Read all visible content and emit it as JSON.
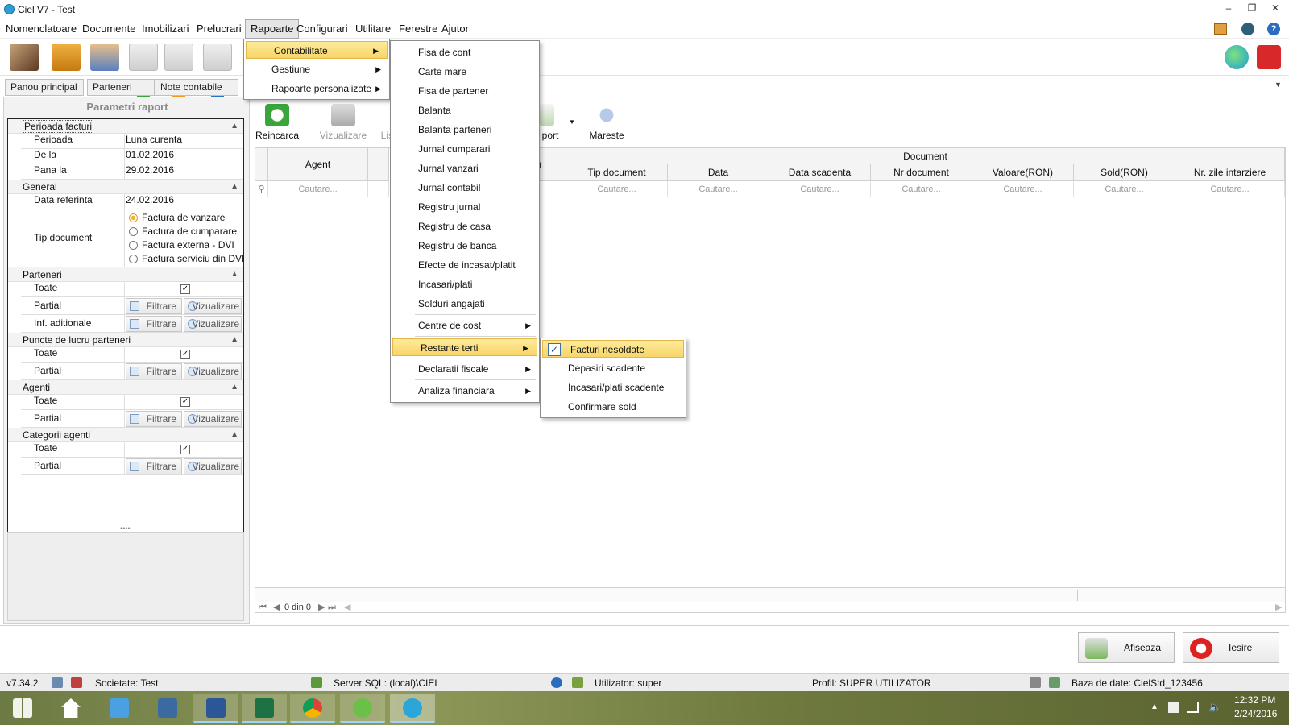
{
  "window": {
    "title": "Ciel V7 - Test",
    "icon": "ciel-logo-icon"
  },
  "menubar": [
    "Nomenclatoare",
    "Documente",
    "Imobilizari",
    "Prelucrari",
    "Rapoarte",
    "Configurari",
    "Utilitare",
    "Ferestre",
    "Ajutor"
  ],
  "active_menu": "Rapoarte",
  "tabs": [
    "Panou principal",
    "Parteneri",
    "Note contabile"
  ],
  "params": {
    "title": "Parametri raport",
    "sections": {
      "perioada": "Perioada facturi",
      "general": "General",
      "parteneri": "Parteneri",
      "puncte": "Puncte de lucru parteneri",
      "agenti": "Agenti",
      "categorii": "Categorii agenti"
    },
    "rows": {
      "perioada_label": "Perioada",
      "perioada_value": "Luna curenta",
      "dela_label": "De la",
      "dela_value": "01.02.2016",
      "panala_label": "Pana la",
      "panala_value": "29.02.2016",
      "dataref_label": "Data referinta",
      "dataref_value": "24.02.2016",
      "tipdoc_label": "Tip document",
      "toate": "Toate",
      "partial": "Partial",
      "infad": "Inf. aditionale"
    },
    "radio_options": [
      "Factura de vanzare",
      "Factura de cumparare",
      "Factura externa - DVI",
      "Factura serviciu din DVI"
    ],
    "radio_selected": 0,
    "filter_label": "Filtrare",
    "view_label": "Vizualizare"
  },
  "report_toolbar": {
    "reload": "Reincarca",
    "view": "Vizualizare",
    "list_partial": "List",
    "export_partial": "port",
    "zoom": "Mareste"
  },
  "grid": {
    "agent_header": "Agent",
    "group_header": "Document",
    "partial_header": "ru",
    "columns": [
      "Tip document",
      "Data",
      "Data scadenta",
      "Nr document",
      "Valoare(RON)",
      "Sold(RON)",
      "Nr. zile intarziere"
    ],
    "search_placeholder": "Cautare...",
    "pager": "0 din 0"
  },
  "buttons": {
    "show": "Afiseaza",
    "exit": "Iesire"
  },
  "status": {
    "version": "v7.34.2",
    "company": "Societate: Test",
    "server": "Server SQL: (local)\\CIEL",
    "user": "Utilizator: super",
    "profile": "Profil: SUPER UTILIZATOR",
    "database": "Baza de date: CielStd_123456"
  },
  "menu_rapoarte": [
    "Contabilitate",
    "Gestiune",
    "Rapoarte personalizate"
  ],
  "menu_contabilitate": [
    "Fisa de cont",
    "Carte mare",
    "Fisa de partener",
    "Balanta",
    "Balanta parteneri",
    "Jurnal cumparari",
    "Jurnal vanzari",
    "Jurnal contabil",
    "Registru jurnal",
    "Registru de casa",
    "Registru de banca",
    "Efecte de incasat/platit",
    "Incasari/plati",
    "Solduri angajati",
    "Centre de cost",
    "Restante terti",
    "Declaratii fiscale",
    "Analiza financiara"
  ],
  "menu_restante": [
    "Facturi nesoldate",
    "Depasiri scadente",
    "Incasari/plati scadente",
    "Confirmare sold"
  ],
  "taskbar": {
    "time": "12:32 PM",
    "date": "2/24/2016"
  },
  "colors": {
    "highlight": "#f7d56a",
    "taskbar": "#6c7a43",
    "accent": "#3d6fb0"
  }
}
